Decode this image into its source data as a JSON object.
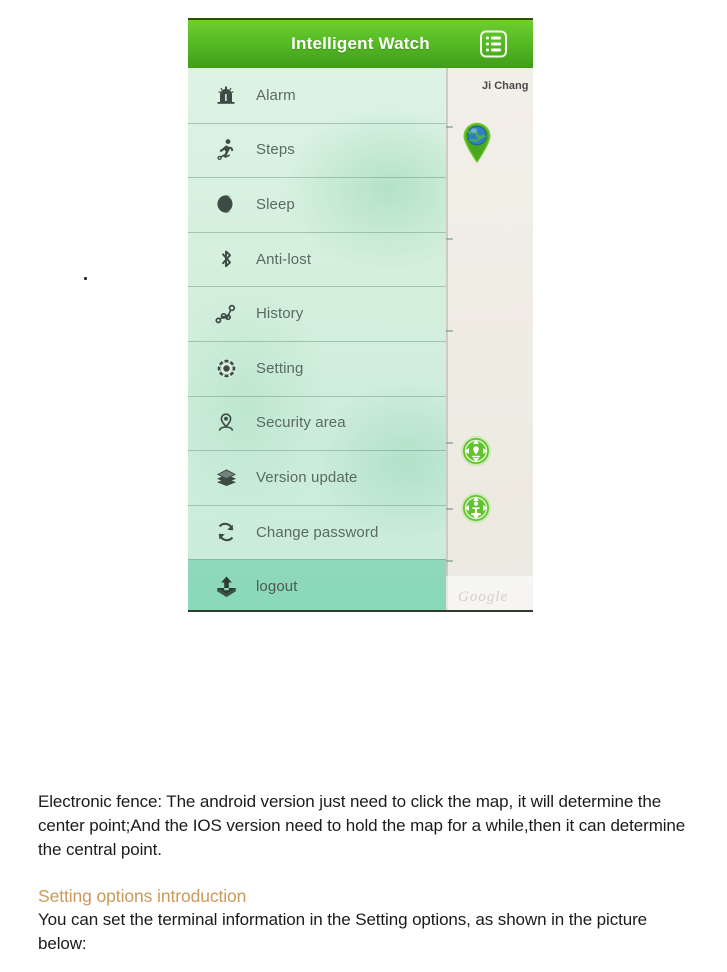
{
  "document": {
    "paragraph_1": "Electronic fence: The android version just need to click the map, it will determine the center point;And the IOS version need to hold the map for a while,then it can determine the central point.",
    "section_heading": "Setting options introduction",
    "paragraph_2": "You can set the terminal information in the Setting options, as shown in the picture below:",
    "heading_color": "#c89a5e"
  },
  "screenshot": {
    "app": {
      "header": {
        "title": "Intelligent Watch",
        "menu_icon": "list-icon",
        "gradient_top": "#6fce31",
        "gradient_bottom": "#3f9e18"
      },
      "menu": {
        "items": [
          {
            "label": "Alarm",
            "icon": "alarm-bell-icon"
          },
          {
            "label": "Steps",
            "icon": "running-person-icon"
          },
          {
            "label": "Sleep",
            "icon": "moon-icon"
          },
          {
            "label": "Anti-lost",
            "icon": "bluetooth-icon"
          },
          {
            "label": "History",
            "icon": "route-history-icon"
          },
          {
            "label": "Setting",
            "icon": "gear-icon"
          },
          {
            "label": "Security area",
            "icon": "location-person-icon"
          },
          {
            "label": "Version update",
            "icon": "layers-stack-icon"
          },
          {
            "label": "Change password",
            "icon": "refresh-cycle-icon"
          },
          {
            "label": "logout",
            "icon": "logout-upload-icon"
          }
        ],
        "background_color": "#d4efdc",
        "logout_background_color": "#8fd9bd"
      },
      "map": {
        "place_label": "Ji Chang",
        "marker_icon": "globe-map-pin-icon",
        "controls": [
          {
            "icon": "locate-me-icon"
          },
          {
            "icon": "street-view-pegman-icon"
          }
        ],
        "watermark": "Google",
        "background_color": "#efece4"
      }
    }
  }
}
